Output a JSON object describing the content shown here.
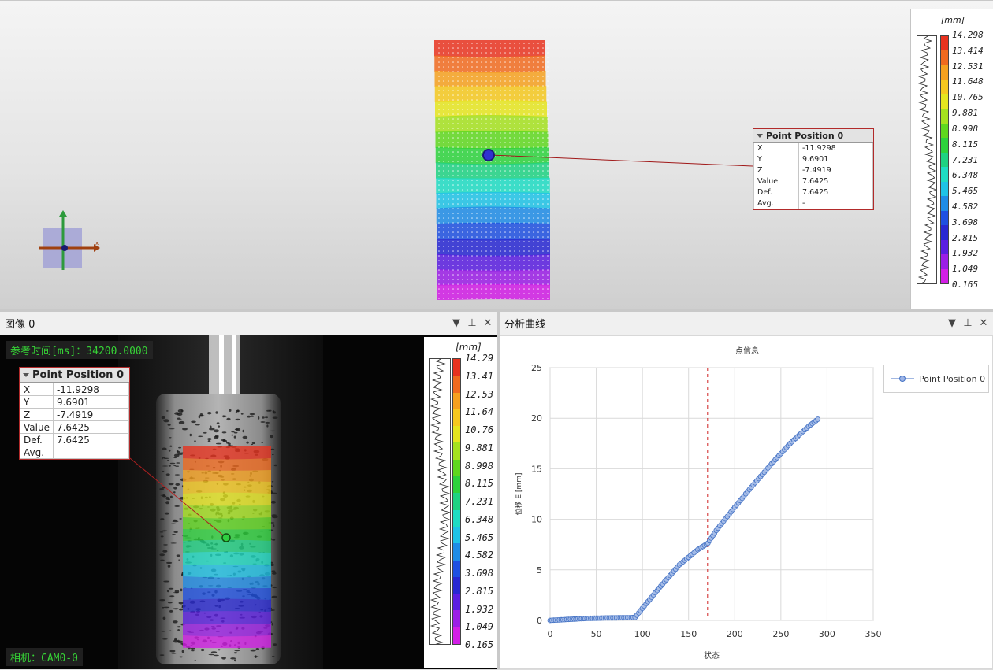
{
  "viewport3d": {
    "info_box": {
      "title": "Point Position 0",
      "rows": [
        {
          "label": "X",
          "value": "-11.9298"
        },
        {
          "label": "Y",
          "value": "9.6901"
        },
        {
          "label": "Z",
          "value": "-7.4919"
        },
        {
          "label": "Value",
          "value": "7.6425"
        },
        {
          "label": "Def.",
          "value": "7.6425"
        },
        {
          "label": "Avg.",
          "value": "-"
        }
      ]
    },
    "axis_labels": {
      "y": "y",
      "x": "x"
    },
    "legend": {
      "unit": "[mm]",
      "labels": [
        "14.298",
        "13.414",
        "12.531",
        "11.648",
        "10.765",
        "9.881",
        "8.998",
        "8.115",
        "7.231",
        "6.348",
        "5.465",
        "4.582",
        "3.698",
        "2.815",
        "1.932",
        "1.049",
        "0.165"
      ]
    }
  },
  "colormap": [
    "#e8321e",
    "#f06a1e",
    "#f5a01e",
    "#f5c81e",
    "#e5e51e",
    "#a5e11e",
    "#5fd71e",
    "#2dd23c",
    "#1ed282",
    "#1edcc3",
    "#1ec3e6",
    "#1e8ce6",
    "#1e50e1",
    "#2828d2",
    "#5a1ee1",
    "#9b1ee6",
    "#d21ee6"
  ],
  "image_panel": {
    "title": "图像 0",
    "ref_time": "参考时间[ms]：34200.0000",
    "camera": "相机：CAM0-0",
    "info_box": {
      "title": "Point Position 0",
      "rows": [
        {
          "label": "X",
          "value": "-11.9298"
        },
        {
          "label": "Y",
          "value": "9.6901"
        },
        {
          "label": "Z",
          "value": "-7.4919"
        },
        {
          "label": "Value",
          "value": "7.6425"
        },
        {
          "label": "Def.",
          "value": "7.6425"
        },
        {
          "label": "Avg.",
          "value": "-"
        }
      ]
    },
    "legend": {
      "unit": "[mm]",
      "labels": [
        "14.29",
        "13.41",
        "12.53",
        "11.64",
        "10.76",
        "9.881",
        "8.998",
        "8.115",
        "7.231",
        "6.348",
        "5.465",
        "4.582",
        "3.698",
        "2.815",
        "1.932",
        "1.049",
        "0.165"
      ]
    }
  },
  "curve_panel": {
    "title": "分析曲线",
    "legend_entry": "Point Position 0"
  },
  "panel_tools": {
    "menu": "▼",
    "pin": "⊥",
    "close": "✕"
  },
  "chart_data": {
    "type": "line",
    "title": "点信息",
    "xlabel": "状态",
    "ylabel": "位移 E [mm]",
    "xlim": [
      0,
      350
    ],
    "ylim": [
      0,
      25
    ],
    "xticks": [
      0,
      50,
      100,
      150,
      200,
      250,
      300,
      350
    ],
    "yticks": [
      0,
      5,
      10,
      15,
      20,
      25
    ],
    "grid": true,
    "legend_position": "top-right",
    "marker_line_x": 171,
    "series": [
      {
        "name": "Point Position 0",
        "color": "#4472c4",
        "x": [
          0,
          10,
          20,
          30,
          40,
          50,
          60,
          70,
          80,
          88,
          92,
          100,
          120,
          140,
          160,
          171,
          180,
          200,
          220,
          240,
          260,
          280,
          290
        ],
        "y": [
          0.0,
          0.05,
          0.1,
          0.15,
          0.2,
          0.22,
          0.24,
          0.25,
          0.26,
          0.27,
          0.3,
          1.2,
          3.4,
          5.5,
          7.0,
          7.64,
          8.9,
          11.2,
          13.4,
          15.5,
          17.5,
          19.2,
          19.9
        ]
      }
    ]
  }
}
